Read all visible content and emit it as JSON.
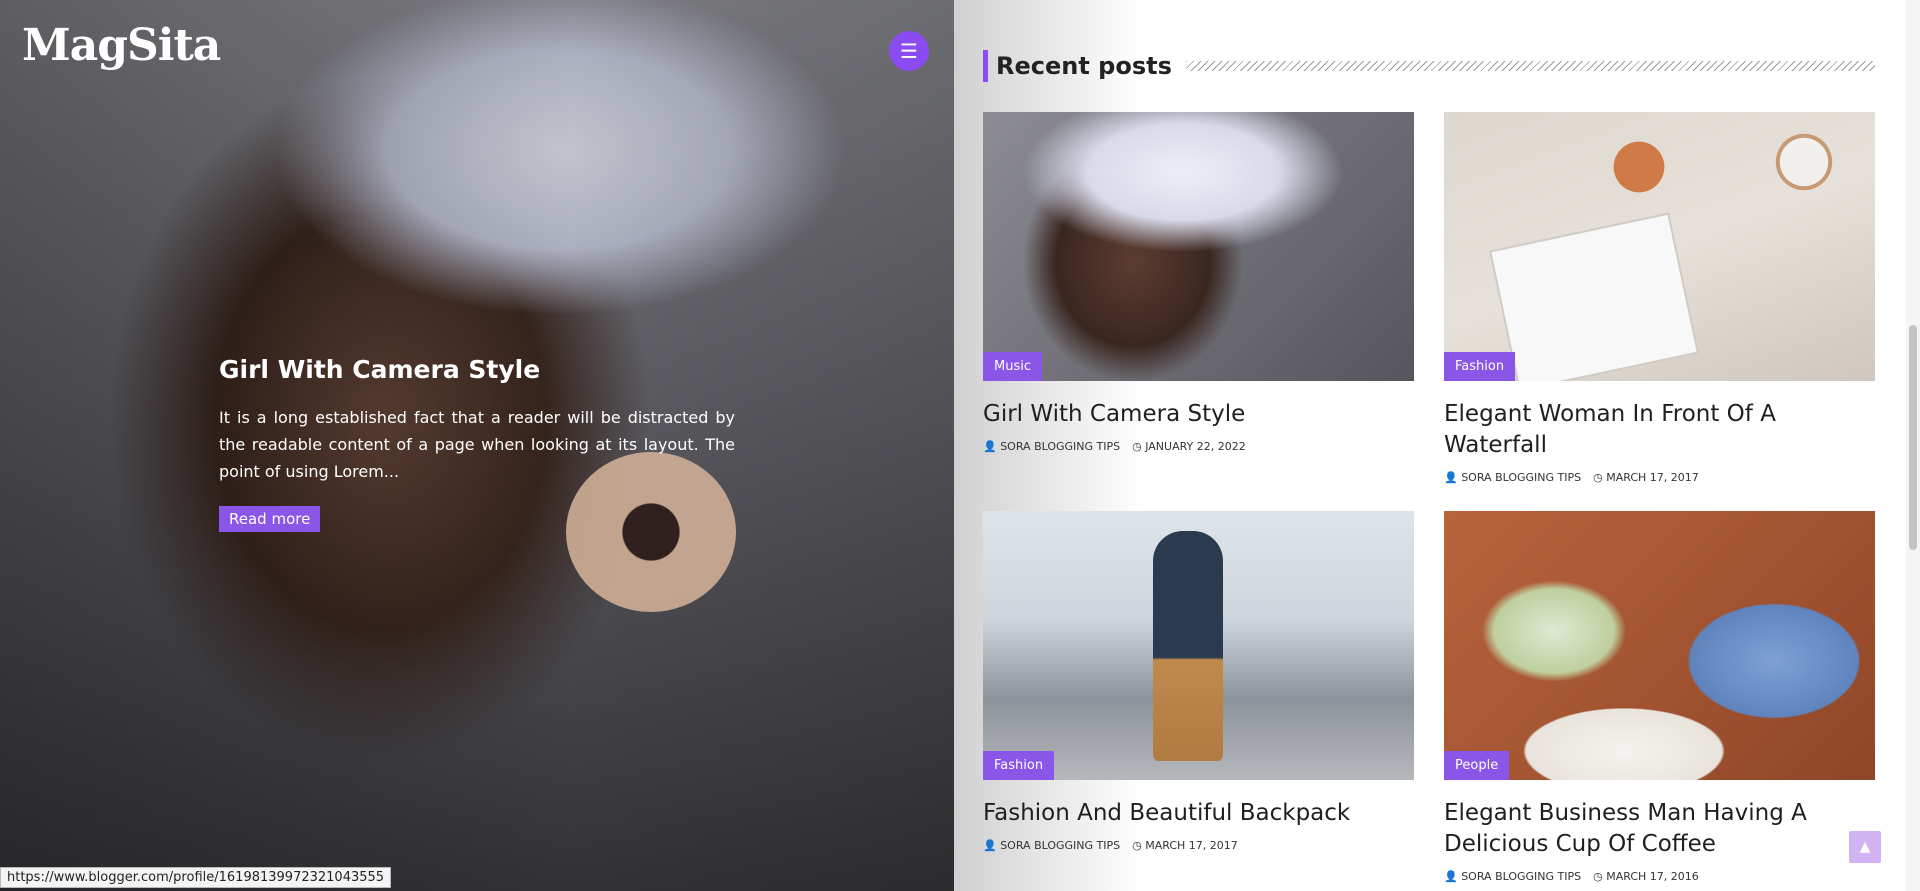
{
  "site": {
    "logo": "MagSita"
  },
  "icons": {
    "menu": "hamburger-menu-icon",
    "user": "user-icon",
    "clock": "clock-icon",
    "scroll_top": "chevron-up-icon"
  },
  "colors": {
    "accent": "#8a4cf0",
    "badge": "#8a56e8"
  },
  "hero": {
    "title": "Girl With Camera Style",
    "excerpt": "It is a long established fact that a reader will be distracted by the readable content of a page when looking at its layout. The point of using Lorem...",
    "button": "Read more"
  },
  "status_url": "https://www.blogger.com/profile/16198139972321043555",
  "recent": {
    "heading": "Recent posts",
    "posts": [
      {
        "category": "Music",
        "title": "Girl With Camera Style",
        "author": "SORA BLOGGING TIPS",
        "date": "JANUARY 22, 2022"
      },
      {
        "category": "Fashion",
        "title": "Elegant Woman In Front Of A Waterfall",
        "author": "SORA BLOGGING TIPS",
        "date": "MARCH 17, 2017"
      },
      {
        "category": "Fashion",
        "title": "Fashion And Beautiful Backpack",
        "author": "SORA BLOGGING TIPS",
        "date": "MARCH 17, 2017"
      },
      {
        "category": "People",
        "title": "Elegant Business Man Having A Delicious Cup Of Coffee",
        "author": "SORA BLOGGING TIPS",
        "date": "MARCH 17, 2016"
      }
    ]
  }
}
